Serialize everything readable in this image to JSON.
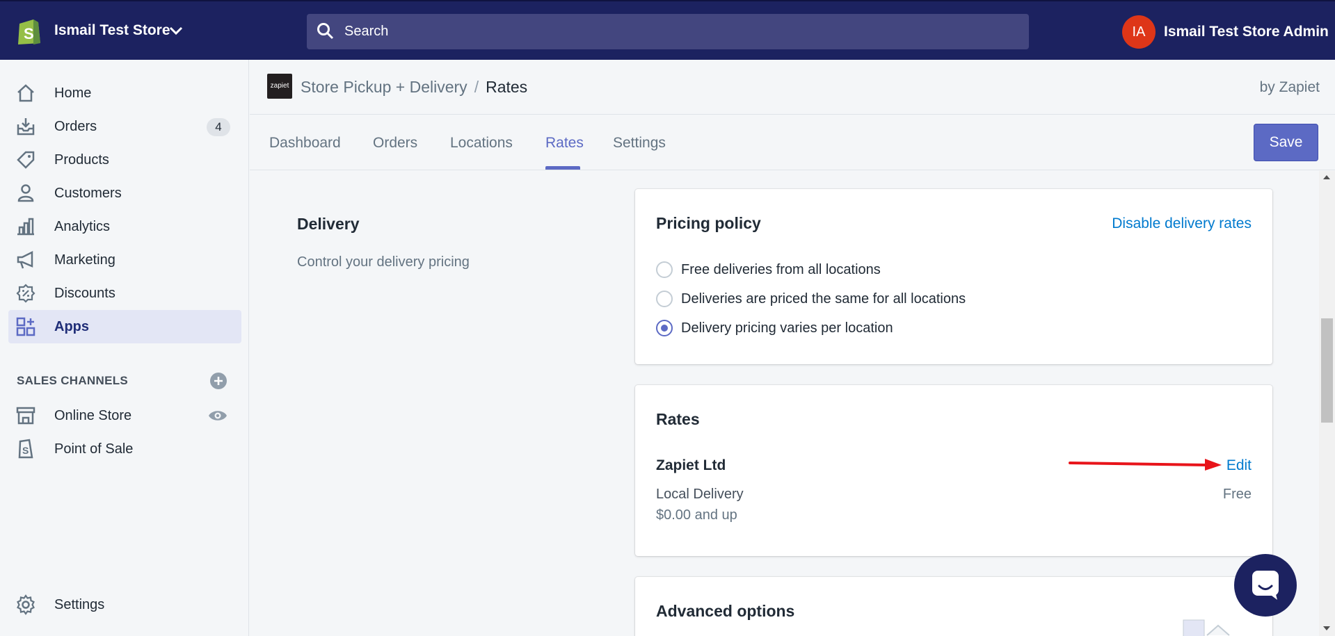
{
  "topbar": {
    "store_name": "Ismail Test Store",
    "search_placeholder": "Search",
    "avatar_initials": "IA",
    "admin_name": "Ismail Test Store Admin"
  },
  "sidebar": {
    "items": [
      {
        "label": "Home",
        "icon": "home-icon"
      },
      {
        "label": "Orders",
        "icon": "orders-icon",
        "badge": "4"
      },
      {
        "label": "Products",
        "icon": "tag-icon"
      },
      {
        "label": "Customers",
        "icon": "person-icon"
      },
      {
        "label": "Analytics",
        "icon": "bar-chart-icon"
      },
      {
        "label": "Marketing",
        "icon": "megaphone-icon"
      },
      {
        "label": "Discounts",
        "icon": "discount-icon"
      },
      {
        "label": "Apps",
        "icon": "apps-icon",
        "active": true
      }
    ],
    "sales_channels_heading": "SALES CHANNELS",
    "channels": [
      {
        "label": "Online Store",
        "icon": "store-icon"
      },
      {
        "label": "Point of Sale",
        "icon": "pos-icon"
      }
    ],
    "settings_label": "Settings"
  },
  "app_header": {
    "logo_text": "zapiet",
    "breadcrumb_parent": "Store Pickup + Delivery",
    "breadcrumb_sep": "/",
    "breadcrumb_current": "Rates",
    "by_line": "by Zapiet"
  },
  "tabs": {
    "items": [
      "Dashboard",
      "Orders",
      "Locations",
      "Rates",
      "Settings"
    ],
    "active": "Rates",
    "save_label": "Save"
  },
  "delivery_section": {
    "title": "Delivery",
    "description": "Control your delivery pricing"
  },
  "pricing_policy": {
    "title": "Pricing policy",
    "disable_link": "Disable delivery rates",
    "options": [
      {
        "label": "Free deliveries from all locations",
        "checked": false
      },
      {
        "label": "Deliveries are priced the same for all locations",
        "checked": false
      },
      {
        "label": "Delivery pricing varies per location",
        "checked": true
      }
    ]
  },
  "rates_card": {
    "title": "Rates",
    "location_name": "Zapiet Ltd",
    "edit_label": "Edit",
    "method": "Local Delivery",
    "condition": "$0.00 and up",
    "price": "Free"
  },
  "advanced_card": {
    "title": "Advanced options"
  },
  "colors": {
    "topbar_bg": "#1c2260",
    "accent": "#5c6ac4",
    "link": "#007ace",
    "avatar": "#de3618",
    "annotation_arrow": "#e8141a"
  }
}
